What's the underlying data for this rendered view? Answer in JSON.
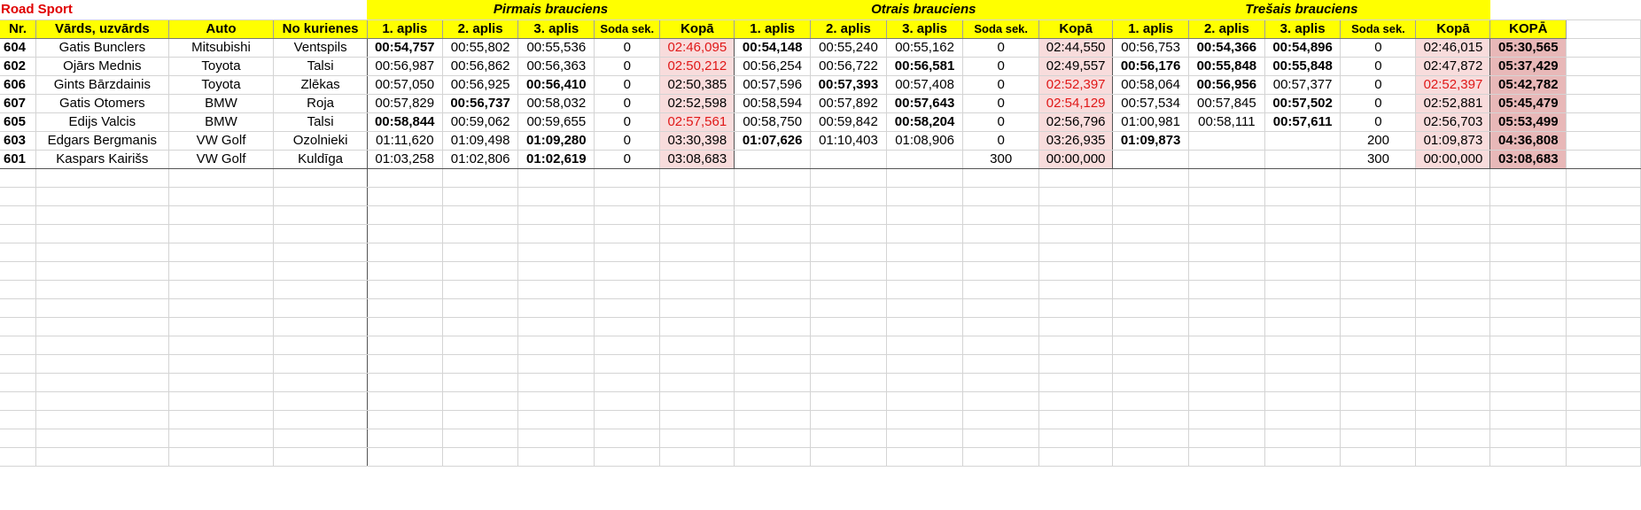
{
  "title": "Road Sport",
  "groups": [
    "Pirmais brauciens",
    "Otrais brauciens",
    "Trešais brauciens"
  ],
  "headers": [
    "Nr.",
    "Vārds, uzvārds",
    "Auto",
    "No kurienes",
    "1. aplis",
    "2. aplis",
    "3. aplis",
    "Soda sek.",
    "Kopā",
    "1. aplis",
    "2. aplis",
    "3. aplis",
    "Soda sek.",
    "Kopā",
    "1. aplis",
    "2. aplis",
    "3. aplis",
    "Soda sek.",
    "Kopā",
    "KOPĀ"
  ],
  "rows": [
    {
      "nr": "604",
      "name": "Gatis Bunclers",
      "auto": "Mitsubishi",
      "from": "Ventspils",
      "cells": [
        "00:54,757",
        "00:55,802",
        "00:55,536",
        "0",
        "02:46,095",
        "00:54,148",
        "00:55,240",
        "00:55,162",
        "0",
        "02:44,550",
        "00:56,753",
        "00:54,366",
        "00:54,896",
        "0",
        "02:46,015",
        "05:30,565"
      ]
    },
    {
      "nr": "602",
      "name": "Ojārs Mednis",
      "auto": "Toyota",
      "from": "Talsi",
      "cells": [
        "00:56,987",
        "00:56,862",
        "00:56,363",
        "0",
        "02:50,212",
        "00:56,254",
        "00:56,722",
        "00:56,581",
        "0",
        "02:49,557",
        "00:56,176",
        "00:55,848",
        "00:55,848",
        "0",
        "02:47,872",
        "05:37,429"
      ]
    },
    {
      "nr": "606",
      "name": "Gints Bārzdainis",
      "auto": "Toyota",
      "from": "Zlēkas",
      "cells": [
        "00:57,050",
        "00:56,925",
        "00:56,410",
        "0",
        "02:50,385",
        "00:57,596",
        "00:57,393",
        "00:57,408",
        "0",
        "02:52,397",
        "00:58,064",
        "00:56,956",
        "00:57,377",
        "0",
        "02:52,397",
        "05:42,782"
      ]
    },
    {
      "nr": "607",
      "name": "Gatis Otomers",
      "auto": "BMW",
      "from": "Roja",
      "cells": [
        "00:57,829",
        "00:56,737",
        "00:58,032",
        "0",
        "02:52,598",
        "00:58,594",
        "00:57,892",
        "00:57,643",
        "0",
        "02:54,129",
        "00:57,534",
        "00:57,845",
        "00:57,502",
        "0",
        "02:52,881",
        "05:45,479"
      ]
    },
    {
      "nr": "605",
      "name": "Edijs Valcis",
      "auto": "BMW",
      "from": "Talsi",
      "cells": [
        "00:58,844",
        "00:59,062",
        "00:59,655",
        "0",
        "02:57,561",
        "00:58,750",
        "00:59,842",
        "00:58,204",
        "0",
        "02:56,796",
        "01:00,981",
        "00:58,111",
        "00:57,611",
        "0",
        "02:56,703",
        "05:53,499"
      ]
    },
    {
      "nr": "603",
      "name": "Edgars Bergmanis",
      "auto": "VW Golf",
      "from": "Ozolnieki",
      "cells": [
        "01:11,620",
        "01:09,498",
        "01:09,280",
        "0",
        "03:30,398",
        "01:07,626",
        "01:10,403",
        "01:08,906",
        "0",
        "03:26,935",
        "01:09,873",
        "",
        "",
        "200",
        "01:09,873",
        "04:36,808"
      ]
    },
    {
      "nr": "601",
      "name": "Kaspars Kairišs",
      "auto": "VW Golf",
      "from": "Kuldīga",
      "cells": [
        "01:03,258",
        "01:02,806",
        "01:02,619",
        "0",
        "03:08,683",
        "",
        "",
        "",
        "300",
        "00:00,000",
        "",
        "",
        "",
        "300",
        "00:00,000",
        "03:08,683"
      ]
    }
  ],
  "bold_cells": [
    [
      0,
      5,
      11,
      12
    ],
    [
      7,
      10,
      11,
      12
    ],
    [
      2,
      6,
      11
    ],
    [
      1,
      7,
      12
    ],
    [
      0,
      7,
      12
    ],
    [
      2,
      5,
      10
    ],
    [
      2
    ]
  ],
  "red_cells": [
    [
      4
    ],
    [
      4
    ],
    [
      9,
      14
    ],
    [
      9
    ],
    [
      4
    ],
    [],
    []
  ],
  "colors": {
    "title": "#e00000",
    "header_bg": "#ffff00",
    "kopa_bg": "#f8dcdc",
    "grand_bg": "#e8b8b8",
    "red_text": "#e01818"
  }
}
